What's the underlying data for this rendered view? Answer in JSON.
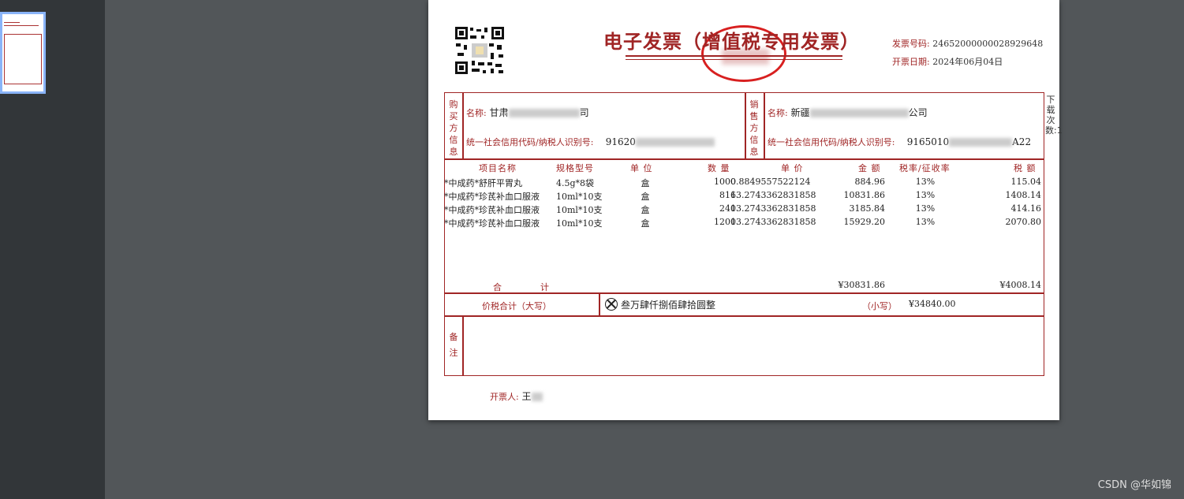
{
  "sidebar": {
    "thumbnail_label": "page-1-thumbnail"
  },
  "invoice": {
    "title": "电子发票（增值税专用发票）",
    "invoice_no_label": "发票号码:",
    "invoice_no": "24652000000028929648",
    "issue_date_label": "开票日期:",
    "issue_date": "2024年06月04日",
    "download_count": "下载次数:1",
    "buyer": {
      "section_label": "购买方信息",
      "name_label": "名称:",
      "name_prefix": "甘肃",
      "name_suffix": "司",
      "tax_label": "统一社会信用代码/纳税人识别号:",
      "tax_prefix": "91620"
    },
    "seller": {
      "section_label": "销售方信息",
      "name_label": "名称:",
      "name_prefix": "新疆",
      "name_suffix": "公司",
      "tax_label": "统一社会信用代码/纳税人识别号:",
      "tax_prefix": "9165010",
      "tax_suffix": "A22"
    },
    "columns": [
      "项目名称",
      "规格型号",
      "单 位",
      "数 量",
      "单 价",
      "金 额",
      "税率/征收率",
      "税 额"
    ],
    "rows": [
      {
        "name": "*中成药*舒肝平胃丸",
        "spec": "4.5g*8袋",
        "unit": "盒",
        "qty": "1000",
        "price": "0.8849557522124",
        "amount": "884.96",
        "rate": "13%",
        "tax": "115.04"
      },
      {
        "name": "*中成药*珍芪补血口服液",
        "spec": "10ml*10支",
        "unit": "盒",
        "qty": "816",
        "price": "13.2743362831858",
        "amount": "10831.86",
        "rate": "13%",
        "tax": "1408.14"
      },
      {
        "name": "*中成药*珍芪补血口服液",
        "spec": "10ml*10支",
        "unit": "盒",
        "qty": "240",
        "price": "13.2743362831858",
        "amount": "3185.84",
        "rate": "13%",
        "tax": "414.16"
      },
      {
        "name": "*中成药*珍芪补血口服液",
        "spec": "10ml*10支",
        "unit": "盒",
        "qty": "1200",
        "price": "13.2743362831858",
        "amount": "15929.20",
        "rate": "13%",
        "tax": "2070.80"
      }
    ],
    "total_label_1": "合",
    "total_label_2": "计",
    "total_amount": "¥30831.86",
    "total_tax": "¥4008.14",
    "grand_total_label": "价税合计（大写）",
    "grand_total_words": "叁万肆仟捌佰肆拾圆整",
    "small_label": "（小写）",
    "grand_total_number": "¥34840.00",
    "remark_label": "备注",
    "issuer_label": "开票人:",
    "issuer_name": "王"
  },
  "watermark": "CSDN @华如锦"
}
